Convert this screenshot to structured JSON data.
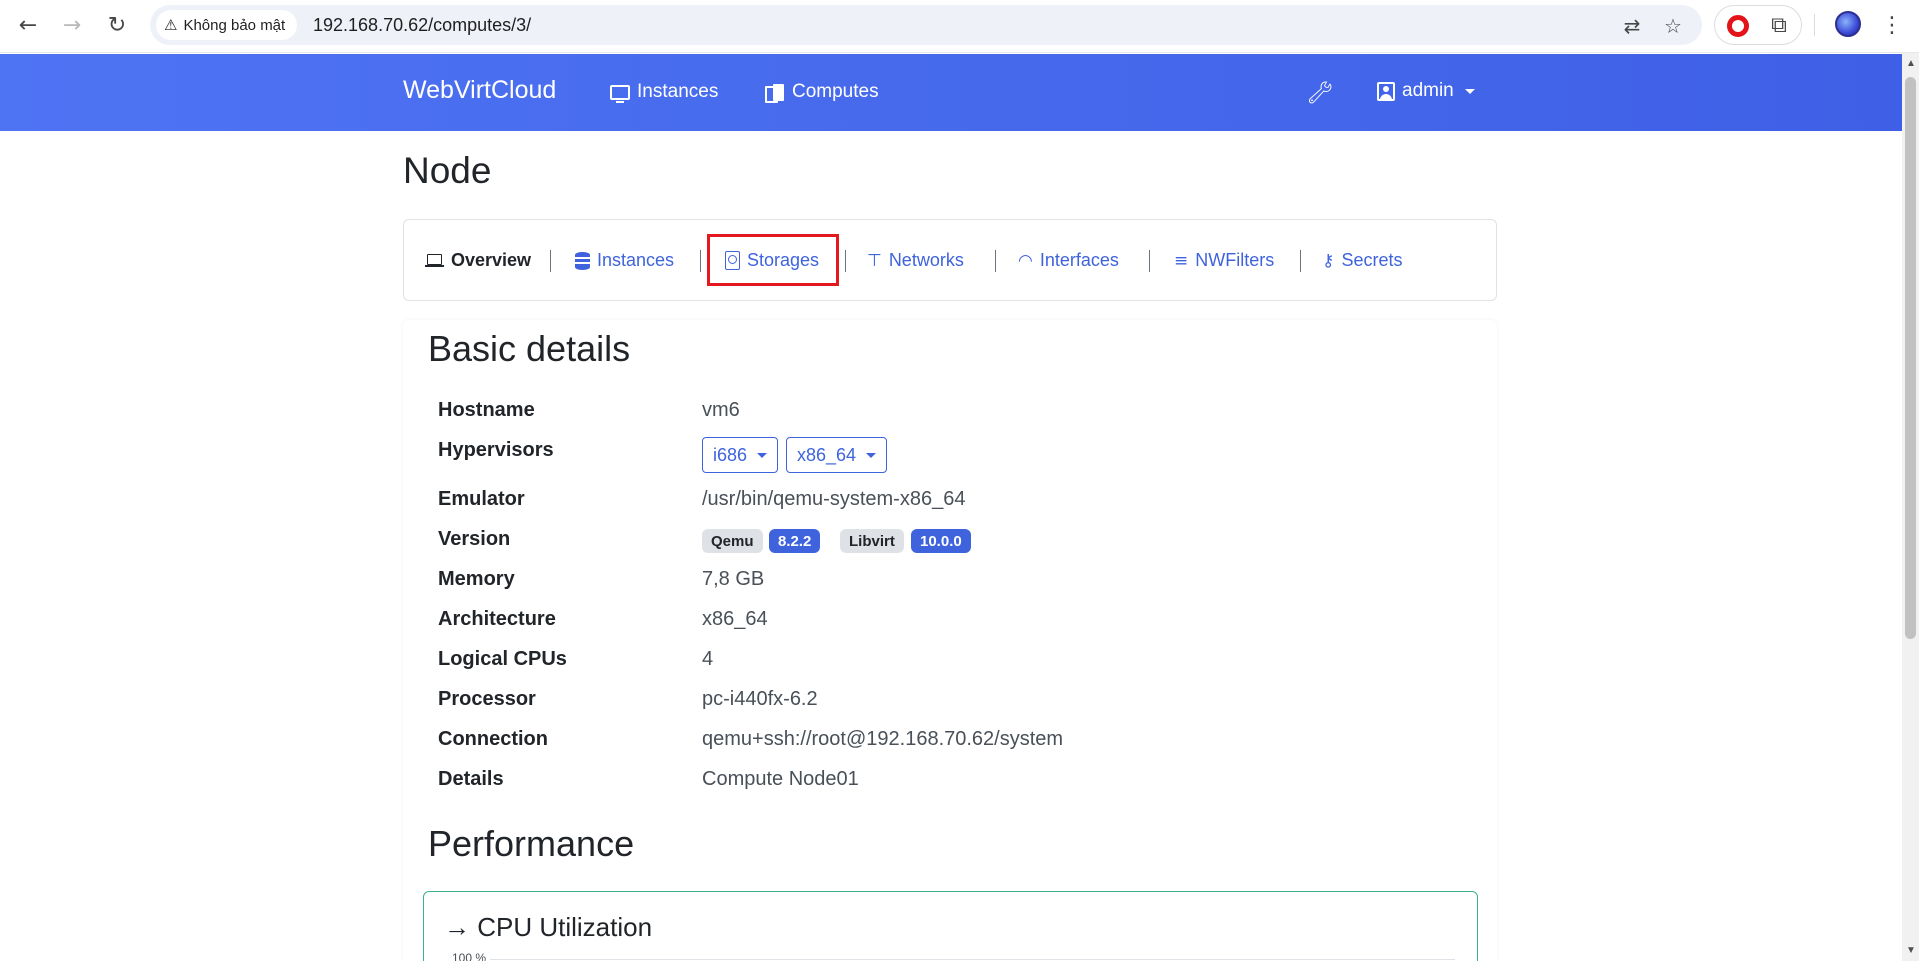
{
  "browser": {
    "security_label": "Không bảo mật",
    "url": "192.168.70.62/computes/3/",
    "icons": [
      "back-icon",
      "forward-icon",
      "reload-icon",
      "warning-icon",
      "translate-icon",
      "star-icon",
      "opera-icon",
      "extensions-icon",
      "profile-icon",
      "menu-icon"
    ]
  },
  "navbar": {
    "brand": "WebVirtCloud",
    "links": [
      {
        "label": "Instances",
        "icon": "monitor-icon"
      },
      {
        "label": "Computes",
        "icon": "server-icon"
      }
    ],
    "settings_icon": "wrench-icon",
    "user_label": "admin",
    "color": "#4e6ff0"
  },
  "page": {
    "title": "Node"
  },
  "tabs": [
    {
      "label": "Overview",
      "icon": "laptop-icon",
      "active": true
    },
    {
      "label": "Instances",
      "icon": "database-icon",
      "active": false
    },
    {
      "label": "Storages",
      "icon": "storage-icon",
      "active": false,
      "highlighted": true
    },
    {
      "label": "Networks",
      "icon": "network-icon",
      "active": false
    },
    {
      "label": "Interfaces",
      "icon": "wifi-icon",
      "active": false
    },
    {
      "label": "NWFilters",
      "icon": "filter-icon",
      "active": false
    },
    {
      "label": "Secrets",
      "icon": "key-icon",
      "active": false
    }
  ],
  "basic_details": {
    "title": "Basic details",
    "rows": [
      {
        "label": "Hostname",
        "value": "vm6"
      },
      {
        "label": "Hypervisors",
        "value": ""
      },
      {
        "label": "Emulator",
        "value": "/usr/bin/qemu-system-x86_64"
      },
      {
        "label": "Version",
        "value": ""
      },
      {
        "label": "Memory",
        "value": "7,8 GB"
      },
      {
        "label": "Architecture",
        "value": "x86_64"
      },
      {
        "label": "Logical CPUs",
        "value": "4"
      },
      {
        "label": "Processor",
        "value": "pc-i440fx-6.2"
      },
      {
        "label": "Connection",
        "value": "qemu+ssh://root@192.168.70.62/system"
      },
      {
        "label": "Details",
        "value": "Compute Node01"
      }
    ],
    "hypervisors": [
      "i686",
      "x86_64"
    ],
    "version_badges": [
      {
        "name": "Qemu",
        "version": "8.2.2"
      },
      {
        "name": "Libvirt",
        "version": "10.0.0"
      }
    ]
  },
  "performance": {
    "title": "Performance",
    "cpu_title": "→ CPU Utilization",
    "cpu_axis_top": "100 %"
  },
  "colors": {
    "accent": "#3e63dd",
    "highlight_border": "#e3191f",
    "perf_border": "#3bb38f"
  }
}
